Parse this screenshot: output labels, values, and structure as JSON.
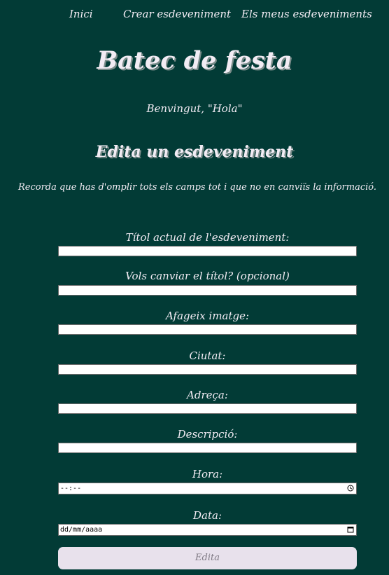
{
  "nav": {
    "items": [
      {
        "label": "Inici"
      },
      {
        "label": "Crear esdeveniment"
      },
      {
        "label": "Els meus esdeveniments"
      }
    ]
  },
  "brand": "Batec de festa",
  "welcome": "Benvingut, \"Hola\"",
  "section_title": "Edita un esdeveniment",
  "notice": "Recorda que has d'omplir tots els camps tot i que no en canviïs la informació.",
  "form": {
    "current_title_label": "Títol actual de l'esdeveniment:",
    "new_title_label": "Vols canviar el títol? (opcional)",
    "image_label": "Afageix imatge:",
    "city_label": "Ciutat:",
    "address_label": "Adreça:",
    "description_label": "Descripció:",
    "time_label": "Hora:",
    "time_value": "--:--",
    "date_label": "Data:",
    "date_value": "dd/mm/aaaa",
    "submit_label": "Edita"
  },
  "icons": {
    "time": "clock-icon",
    "date": "calendar-icon"
  },
  "colors": {
    "background": "#023b36",
    "text": "#f2ecf4",
    "button_bg": "#e8e1ec",
    "button_text": "#7f7a84"
  }
}
